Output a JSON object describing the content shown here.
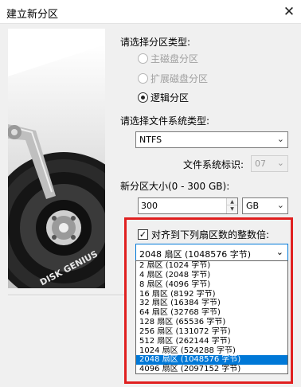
{
  "window": {
    "title": "建立新分区",
    "close_glyph": "✕"
  },
  "partition_type": {
    "label": "请选择分区类型:",
    "options": [
      {
        "label": "主磁盘分区",
        "checked": false,
        "enabled": false
      },
      {
        "label": "扩展磁盘分区",
        "checked": false,
        "enabled": false
      },
      {
        "label": "逻辑分区",
        "checked": true,
        "enabled": true
      }
    ]
  },
  "filesystem": {
    "label": "请选择文件系统类型:",
    "value": "NTFS",
    "id_label": "文件系统标识:",
    "id_value": "07"
  },
  "size": {
    "label": "新分区大小(0 - 300 GB):",
    "value": "300",
    "unit": "GB"
  },
  "alignment": {
    "checkbox_label": "对齐到下列扇区数的整数倍:",
    "checked": true,
    "selected": "2048 扇区 (1048576 字节)",
    "options": [
      "2 扇区 (1024 字节)",
      "4 扇区 (2048 字节)",
      "8 扇区 (4096 字节)",
      "16 扇区 (8192 字节)",
      "32 扇区 (16384 字节)",
      "64 扇区 (32768 字节)",
      "128 扇区 (65536 字节)",
      "256 扇区 (131072 字节)",
      "512 扇区 (262144 字节)",
      "1024 扇区 (524288 字节)",
      "2048 扇区 (1048576 字节)",
      "4096 扇区 (2097152 字节)"
    ],
    "selected_index": 10
  },
  "artwork": {
    "brand_text": "DISK GENIUS"
  },
  "colors": {
    "highlight": "#0078d7",
    "frame": "#e02020"
  }
}
